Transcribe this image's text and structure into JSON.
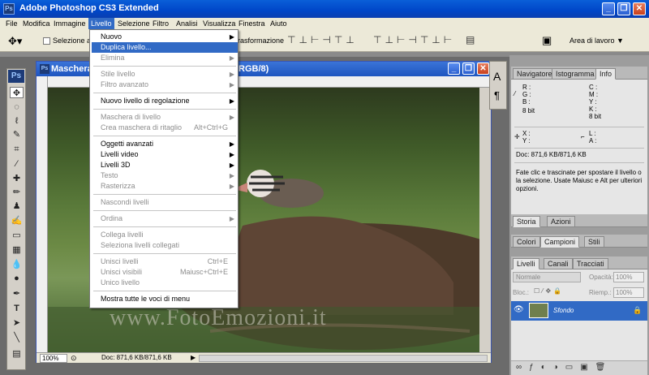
{
  "app": {
    "title": "Adobe Photoshop CS3 Extended",
    "icon": "Ps"
  },
  "menubar": [
    "File",
    "Modifica",
    "Immagine",
    "Livello",
    "Selezione",
    "Filtro",
    "Analisi",
    "Visualizza",
    "Finestra",
    "Aiuto"
  ],
  "options": {
    "checkbox_label": "Selezione aut",
    "transform_label": "rasformazione",
    "workspace_label": "Area di lavoro"
  },
  "document": {
    "title": "Maschera",
    "mode": "RGB/8",
    "zoom": "100%",
    "doc_info": "Doc: 871,6 KB/871,6 KB",
    "watermark": "www.FotoEmozioni.it"
  },
  "menu": {
    "items": [
      {
        "label": "Nuovo",
        "arrow": true
      },
      {
        "label": "Duplica livello...",
        "selected": true
      },
      {
        "label": "Elimina",
        "arrow": true,
        "disabled": true
      },
      {
        "sep": true
      },
      {
        "label": "Stile livello",
        "arrow": true,
        "disabled": true
      },
      {
        "label": "Filtro avanzato",
        "arrow": true,
        "disabled": true
      },
      {
        "sep": true
      },
      {
        "label": "Nuovo livello di regolazione",
        "arrow": true
      },
      {
        "sep": true
      },
      {
        "label": "Maschera di livello",
        "arrow": true,
        "disabled": true
      },
      {
        "label": "Crea maschera di ritaglio",
        "shortcut": "Alt+Ctrl+G",
        "disabled": true
      },
      {
        "sep": true
      },
      {
        "label": "Oggetti avanzati",
        "arrow": true
      },
      {
        "label": "Livelli video",
        "arrow": true
      },
      {
        "label": "Livelli 3D",
        "arrow": true
      },
      {
        "label": "Testo",
        "arrow": true,
        "disabled": true
      },
      {
        "label": "Rasterizza",
        "arrow": true,
        "disabled": true
      },
      {
        "sep": true
      },
      {
        "label": "Nascondi livelli",
        "disabled": true
      },
      {
        "sep": true
      },
      {
        "label": "Ordina",
        "arrow": true,
        "disabled": true
      },
      {
        "sep": true
      },
      {
        "label": "Collega livelli",
        "disabled": true
      },
      {
        "label": "Seleziona livelli collegati",
        "disabled": true
      },
      {
        "sep": true
      },
      {
        "label": "Unisci livelli",
        "shortcut": "Ctrl+E",
        "disabled": true
      },
      {
        "label": "Unisci visibili",
        "shortcut": "Maiusc+Ctrl+E",
        "disabled": true
      },
      {
        "label": "Unico livello",
        "disabled": true
      },
      {
        "sep": true
      },
      {
        "label": "Mostra tutte le voci di menu"
      }
    ]
  },
  "info_panel": {
    "tabs": [
      "Navigatore",
      "Istogramma",
      "Info"
    ],
    "rgb": [
      "R :",
      "G :",
      "B :"
    ],
    "cmyk": [
      "C :",
      "M :",
      "Y :",
      "K :"
    ],
    "bits_left": "8 bit",
    "bits_right": "8 bit",
    "xy": [
      "X :",
      "Y :"
    ],
    "lw": [
      "L :",
      "A :"
    ],
    "doc": "Doc: 871,6 KB/871,6 KB",
    "hint": "Fate clic e trascinate per spostare il livello o la selezione. Usate Maiusc e Alt per ulteriori opzioni."
  },
  "history_panel": {
    "tabs": [
      "Storia",
      "Azioni"
    ]
  },
  "color_panel": {
    "tabs": [
      "Colori",
      "Campioni",
      "Stili"
    ]
  },
  "layers_panel": {
    "tabs": [
      "Livelli",
      "Canali",
      "Tracciati"
    ],
    "blend": "Normale",
    "opacity_label": "Opacità:",
    "opacity": "100%",
    "lock_label": "Bloc.:",
    "fill_label": "Riemp.:",
    "fill": "100%",
    "layer_name": "Sfondo"
  },
  "colors": {
    "xp_blue": "#0a5fd8",
    "menu_highlight": "#316ac5"
  }
}
